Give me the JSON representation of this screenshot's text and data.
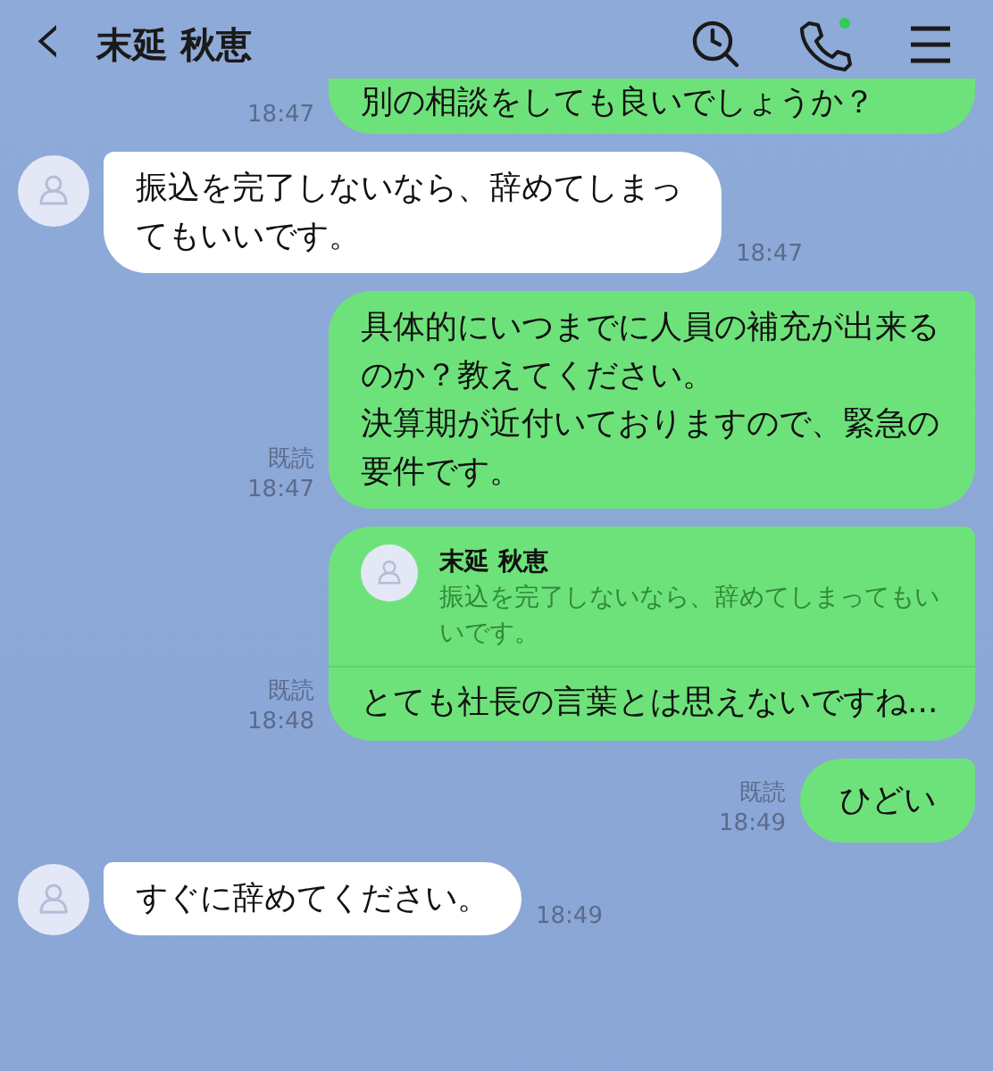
{
  "header": {
    "back": "‹",
    "title": "末延 秋恵"
  },
  "messages": [
    {
      "kind": "partial",
      "text": "別の相談をしても良いでしょうか？",
      "time": "18:47"
    },
    {
      "kind": "received",
      "text": "振込を完了しないなら、辞めてしまってもいいです。",
      "time": "18:47"
    },
    {
      "kind": "sent",
      "paragraphs": [
        "具体的にいつまでに人員の補充が出来るのか？教えてください。",
        "決算期が近付いておりますので、緊急の要件です。"
      ],
      "read": "既読",
      "time": "18:47"
    },
    {
      "kind": "reply",
      "quote_name": "末延 秋恵",
      "quote_text": "振込を完了しないなら、辞めてしまってもいいです。",
      "text": "とても社長の言葉とは思えないですね...",
      "read": "既読",
      "time": "18:48"
    },
    {
      "kind": "sent",
      "text": "ひどい",
      "read": "既読",
      "time": "18:49"
    },
    {
      "kind": "received",
      "text": "すぐに辞めてください。",
      "time": "18:49"
    }
  ]
}
